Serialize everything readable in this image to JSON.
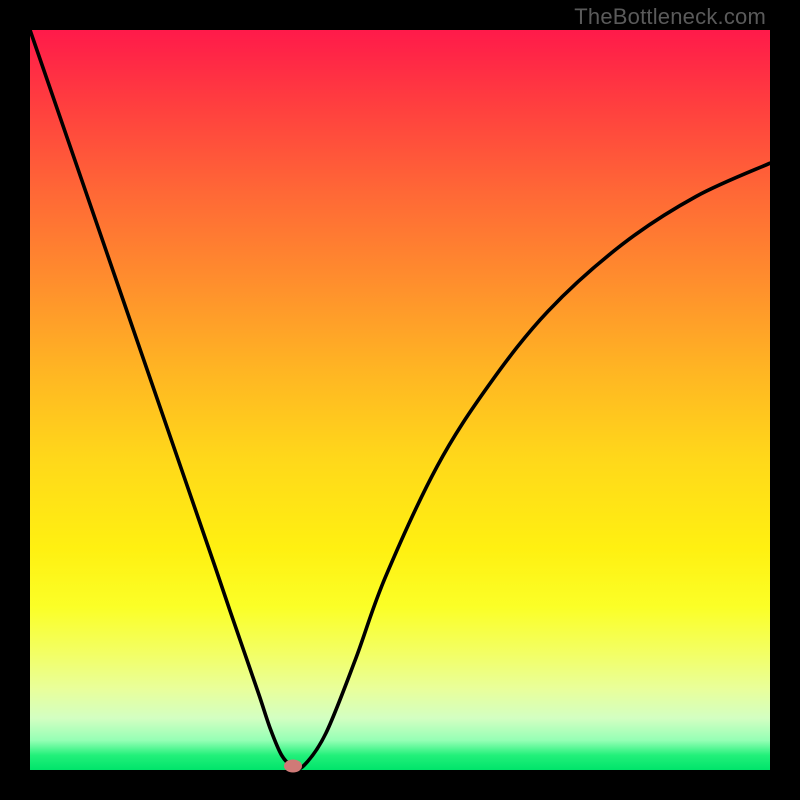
{
  "watermark": "TheBottleneck.com",
  "chart_data": {
    "type": "line",
    "title": "",
    "xlabel": "",
    "ylabel": "",
    "xlim": [
      0,
      100
    ],
    "ylim": [
      0,
      100
    ],
    "series": [
      {
        "name": "curve",
        "x": [
          0,
          5,
          10,
          15,
          20,
          25,
          27,
          29,
          31,
          32.5,
          34,
          35.5,
          37,
          40,
          44,
          48,
          55,
          62,
          70,
          80,
          90,
          100
        ],
        "y": [
          100,
          85.5,
          71,
          56.5,
          42,
          27.5,
          21.6,
          15.8,
          10,
          5.5,
          2,
          0.5,
          0.6,
          5,
          15,
          26,
          41,
          52,
          62,
          71,
          77.5,
          82
        ]
      }
    ],
    "marker": {
      "x": 35.5,
      "y": 0.5
    },
    "background_gradient": {
      "direction": "vertical",
      "stops": [
        {
          "pos": 0,
          "color": "#ff1a4a"
        },
        {
          "pos": 50,
          "color": "#ffd81a"
        },
        {
          "pos": 100,
          "color": "#00e46b"
        }
      ]
    }
  }
}
